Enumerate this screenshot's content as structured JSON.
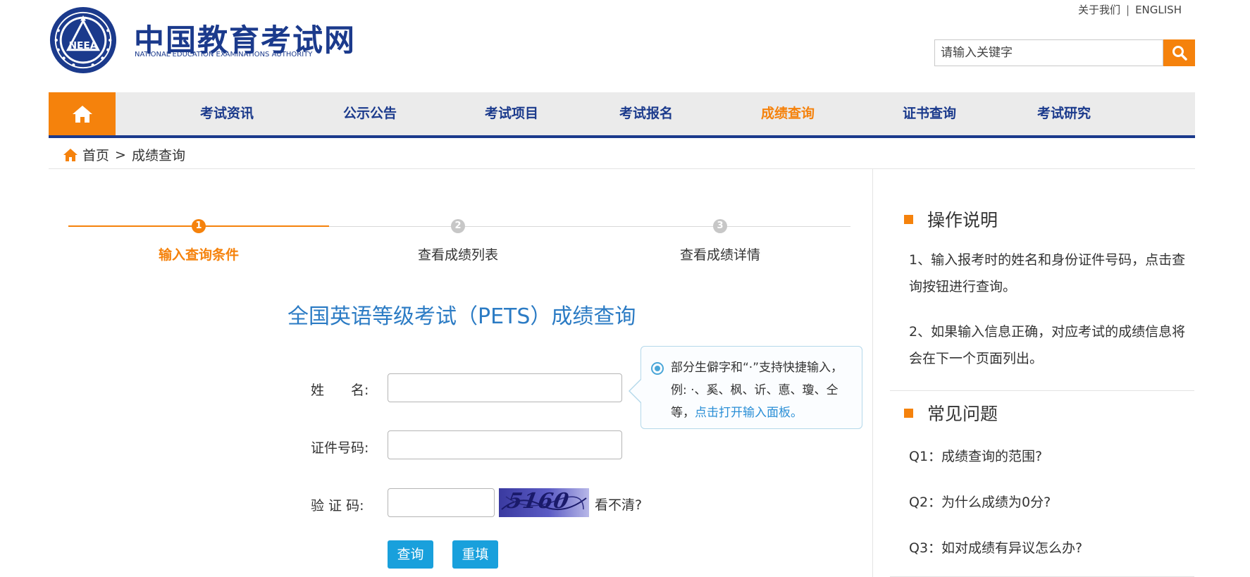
{
  "header": {
    "top_links": [
      "关于我们",
      "ENGLISH"
    ],
    "separator": "|",
    "logo_emblem_text": "NEEA",
    "logo_cn": "中国教育考试网",
    "logo_en": "NATIONAL EDUCATION EXAMINATIONS AUTHORITY",
    "search_placeholder": "请输入关键字"
  },
  "nav": {
    "items": [
      "考试资讯",
      "公示公告",
      "考试项目",
      "考试报名",
      "成绩查询",
      "证书查询",
      "考试研究"
    ],
    "active_index": 4
  },
  "breadcrumb": {
    "home": "首页",
    "separator": ">",
    "current": "成绩查询"
  },
  "steps": [
    {
      "num": "1",
      "label": "输入查询条件",
      "active": true
    },
    {
      "num": "2",
      "label": "查看成绩列表",
      "active": false
    },
    {
      "num": "3",
      "label": "查看成绩详情",
      "active": false
    }
  ],
  "form": {
    "title": "全国英语等级考试（PETS）成绩查询",
    "name_label": "姓　　名:",
    "id_label": "证件号码:",
    "captcha_label": "验 证 码:",
    "name_value": "",
    "id_value": "",
    "captcha_value": "",
    "captcha_text": "5160",
    "refresh_label": "看不清?",
    "submit_label": "查询",
    "reset_label": "重填"
  },
  "tip": {
    "text_before": "部分生僻字和“·”支持快捷输入，例: ·、奚、枫、䜣、悳、瓊、仝等，",
    "link": "点击打开输入面板。"
  },
  "sidebar": {
    "instructions_title": "操作说明",
    "instructions": [
      "1、输入报考时的姓名和身份证件号码，点击查询按钮进行查询。",
      "2、如果输入信息正确，对应考试的成绩信息将会在下一个页面列出。"
    ],
    "faq_title": "常见问题",
    "faq": [
      "Q1：成绩查询的范围?",
      "Q2：为什么成绩为0分?",
      "Q3：如对成绩有异议怎么办?"
    ]
  },
  "colors": {
    "brand_blue": "#1b3a8c",
    "accent_orange": "#f5820c",
    "button_blue": "#19a0dc",
    "title_blue": "#2b7bc4"
  }
}
